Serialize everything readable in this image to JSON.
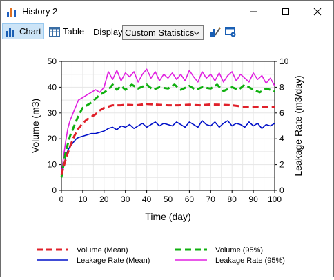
{
  "window": {
    "title": "History 2"
  },
  "toolbar": {
    "chart_label": "Chart",
    "table_label": "Table",
    "display_label": "Display:",
    "display_value": "Custom Statistics"
  },
  "chart_data": {
    "type": "line",
    "xlabel": "Time (day)",
    "ylabel": "Volume (m3)",
    "y2label": "Leakage Rate (m3/day)",
    "xlim": [
      0,
      100
    ],
    "ylim": [
      0,
      50
    ],
    "y2lim": [
      0,
      10
    ],
    "xticks": [
      0,
      10,
      20,
      30,
      40,
      50,
      60,
      70,
      80,
      90,
      100
    ],
    "yticks": [
      0,
      10,
      20,
      30,
      40,
      50
    ],
    "y2ticks": [
      0,
      2,
      4,
      6,
      8,
      10
    ],
    "grid": true,
    "legend": "bottom",
    "series": [
      {
        "name": "Volume (Mean)",
        "axis": "left",
        "color": "#e0202a",
        "dash": true,
        "x": [
          0,
          2,
          4,
          6,
          8,
          10,
          12,
          14,
          16,
          18,
          20,
          22,
          24,
          26,
          28,
          30,
          35,
          40,
          45,
          50,
          55,
          60,
          65,
          70,
          75,
          80,
          85,
          90,
          95,
          100
        ],
        "y": [
          6,
          12,
          17,
          21,
          24,
          26,
          27.5,
          28.5,
          29.5,
          31,
          32,
          32.5,
          33,
          33,
          33,
          33.2,
          33,
          33.5,
          33.2,
          33,
          33,
          33.2,
          33,
          33.3,
          33.2,
          33,
          32.5,
          32.5,
          32.3,
          32.5
        ]
      },
      {
        "name": "Volume (95%)",
        "axis": "left",
        "color": "#10b010",
        "dash": true,
        "x": [
          0,
          2,
          4,
          6,
          8,
          10,
          12,
          14,
          16,
          18,
          20,
          22,
          24,
          26,
          28,
          30,
          33,
          36,
          40,
          43,
          46,
          50,
          53,
          56,
          60,
          63,
          66,
          70,
          73,
          76,
          80,
          83,
          86,
          90,
          93,
          96,
          100
        ],
        "y": [
          5,
          15,
          21,
          25,
          29,
          32,
          33,
          34,
          35.5,
          37,
          38,
          39,
          41,
          39,
          40.5,
          39,
          41,
          39.5,
          41,
          39,
          40,
          39.5,
          41,
          39,
          40.5,
          39,
          40,
          39.5,
          41,
          38.5,
          40,
          39,
          41,
          39,
          38,
          39.5,
          38.5
        ]
      },
      {
        "name": "Leakage Rate (Mean)",
        "axis": "right",
        "color": "#0010c8",
        "dash": false,
        "x": [
          0,
          1,
          2,
          3,
          4,
          5,
          6,
          7,
          8,
          10,
          12,
          14,
          16,
          18,
          20,
          22,
          24,
          26,
          28,
          30,
          32,
          34,
          36,
          38,
          40,
          42,
          44,
          46,
          48,
          50,
          52,
          54,
          56,
          58,
          60,
          62,
          64,
          66,
          68,
          70,
          72,
          74,
          76,
          78,
          80,
          82,
          84,
          86,
          88,
          90,
          92,
          94,
          96,
          98,
          100
        ],
        "y": [
          1.2,
          1.8,
          2.6,
          3.1,
          3.4,
          3.6,
          3.8,
          4.0,
          4.1,
          4.2,
          4.3,
          4.4,
          4.4,
          4.5,
          4.6,
          4.8,
          4.9,
          4.7,
          5.0,
          4.9,
          5.1,
          4.8,
          5.0,
          5.2,
          4.9,
          5.1,
          5.3,
          5.0,
          5.2,
          5.1,
          5.0,
          5.3,
          5.1,
          4.9,
          5.3,
          5.1,
          4.9,
          5.4,
          5.1,
          5.0,
          5.3,
          4.9,
          5.2,
          5.4,
          5.0,
          5.2,
          5.1,
          4.9,
          5.3,
          5.0,
          5.2,
          4.8,
          5.1,
          5.0,
          5.2
        ]
      },
      {
        "name": "Leakage Rate (95%)",
        "axis": "right",
        "color": "#e020e0",
        "dash": false,
        "x": [
          0,
          1,
          2,
          3,
          4,
          5,
          6,
          7,
          8,
          10,
          12,
          14,
          16,
          18,
          20,
          22,
          24,
          26,
          28,
          30,
          32,
          34,
          36,
          38,
          40,
          42,
          44,
          46,
          48,
          50,
          52,
          54,
          56,
          58,
          60,
          62,
          64,
          66,
          68,
          70,
          72,
          74,
          76,
          78,
          80,
          82,
          84,
          86,
          88,
          90,
          92,
          94,
          96,
          98,
          100
        ],
        "y": [
          1.2,
          2.6,
          3.8,
          4.8,
          5.4,
          5.8,
          6.2,
          6.6,
          7.0,
          7.2,
          7.4,
          7.6,
          7.8,
          7.6,
          8.0,
          9.2,
          8.6,
          9.3,
          8.5,
          9.1,
          8.8,
          9.2,
          8.4,
          9.0,
          9.4,
          8.7,
          9.2,
          8.5,
          9.0,
          8.7,
          9.1,
          8.6,
          9.0,
          8.5,
          9.3,
          8.8,
          8.4,
          9.2,
          8.7,
          9.0,
          8.5,
          9.1,
          8.4,
          8.9,
          9.2,
          8.5,
          9.0,
          8.7,
          8.4,
          9.1,
          8.6,
          8.9,
          8.3,
          8.7,
          8.1
        ]
      }
    ]
  }
}
